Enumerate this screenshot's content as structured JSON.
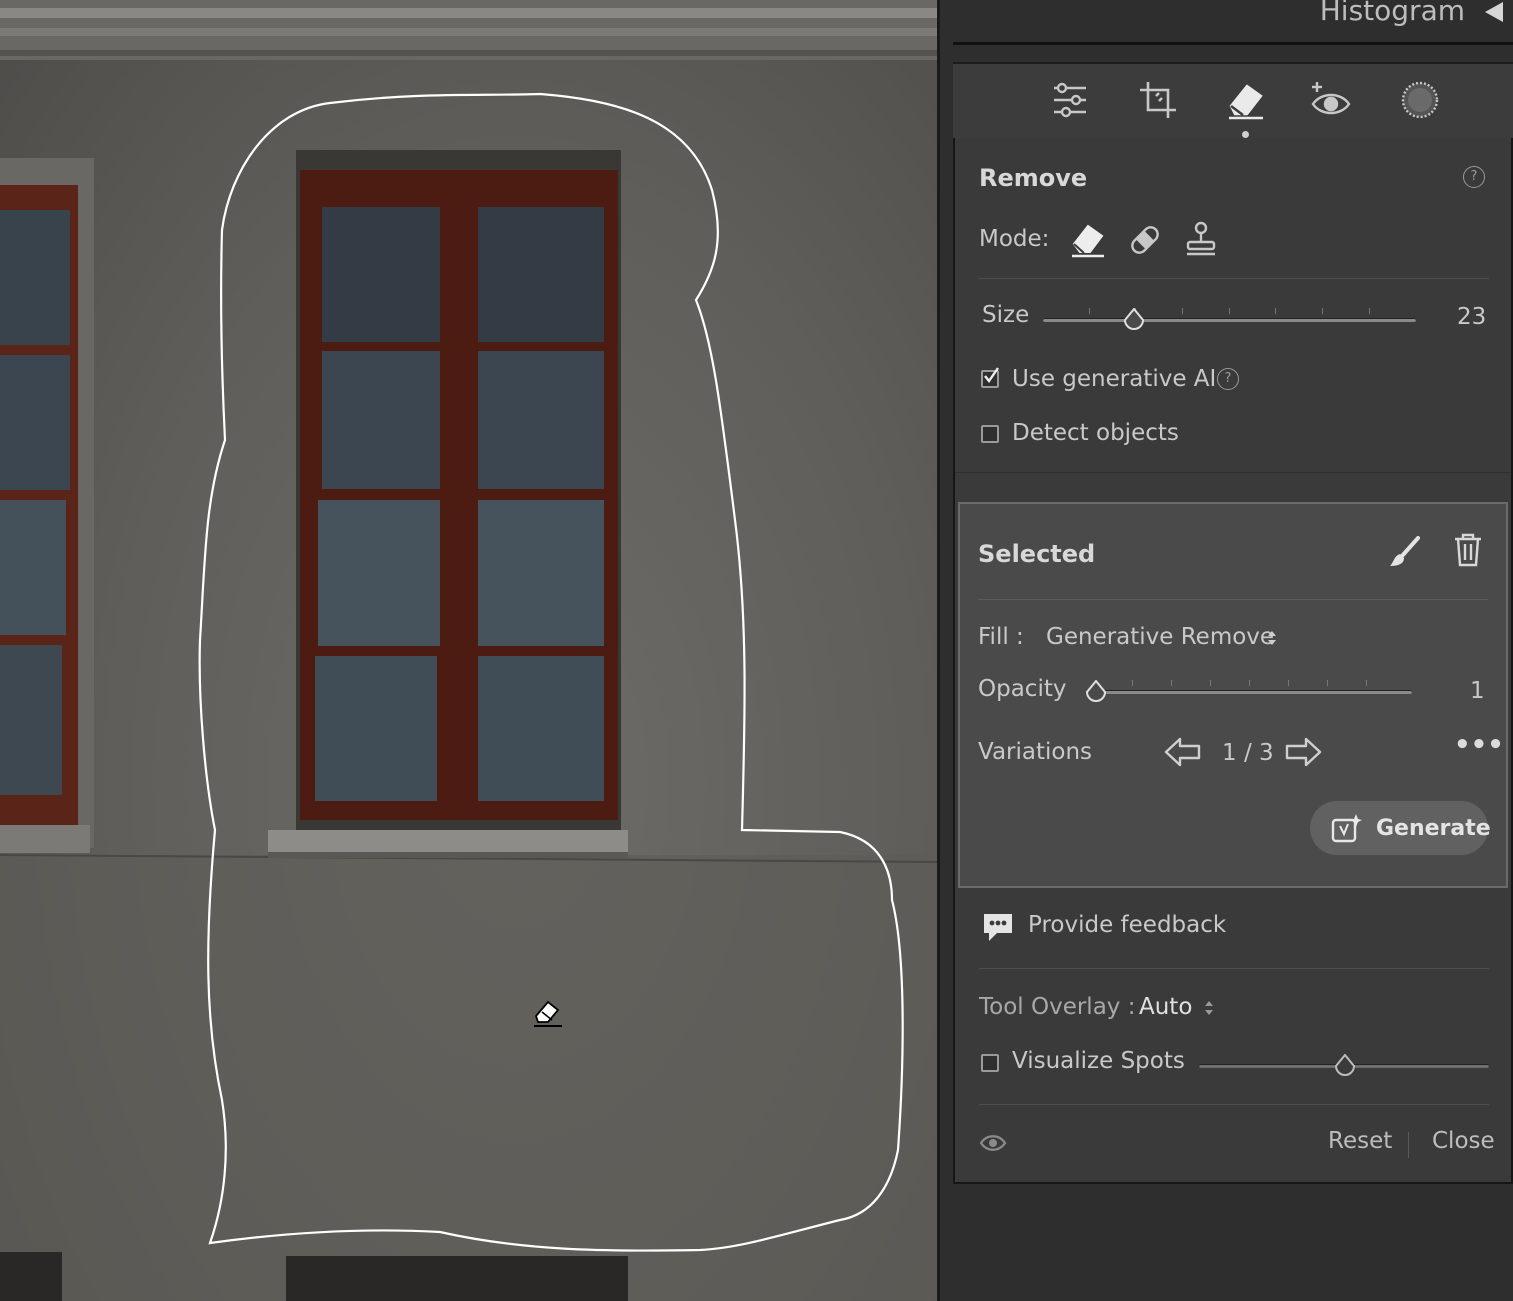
{
  "header": {
    "histogram_label": "Histogram"
  },
  "tools": [
    {
      "name": "edit-sliders-icon"
    },
    {
      "name": "crop-icon"
    },
    {
      "name": "remove-eraser-icon",
      "active": true
    },
    {
      "name": "red-eye-icon"
    },
    {
      "name": "masking-icon"
    }
  ],
  "remove_panel": {
    "title": "Remove",
    "mode_label": "Mode:",
    "modes": [
      "remove-eraser-icon",
      "heal-bandage-icon",
      "clone-stamp-icon"
    ],
    "size_label": "Size",
    "size_value": "23",
    "size_fraction": 0.24,
    "generative_ai_label": "Use generative AI",
    "generative_ai_checked": true,
    "detect_objects_label": "Detect objects",
    "detect_objects_checked": false
  },
  "selected": {
    "title": "Selected",
    "fill_label": "Fill :",
    "fill_value": "Generative Remove",
    "opacity_label": "Opacity",
    "opacity_value": "1",
    "opacity_fraction": 0.0,
    "variations_label": "Variations",
    "variations_value": "1 / 3",
    "generate_label": "Generate"
  },
  "footer": {
    "feedback_label": "Provide feedback",
    "tool_overlay_label": "Tool Overlay :",
    "tool_overlay_value": "Auto",
    "visualize_spots_label": "Visualize Spots",
    "visualize_spots_checked": false,
    "visualize_fraction": 0.5,
    "reset_label": "Reset",
    "close_label": "Close"
  },
  "colors": {
    "panel_bg": "#3a3a3a",
    "selected_bg": "#4a4a4a",
    "window_frame": "#5a2418",
    "mask_outline": "#ffffff"
  }
}
